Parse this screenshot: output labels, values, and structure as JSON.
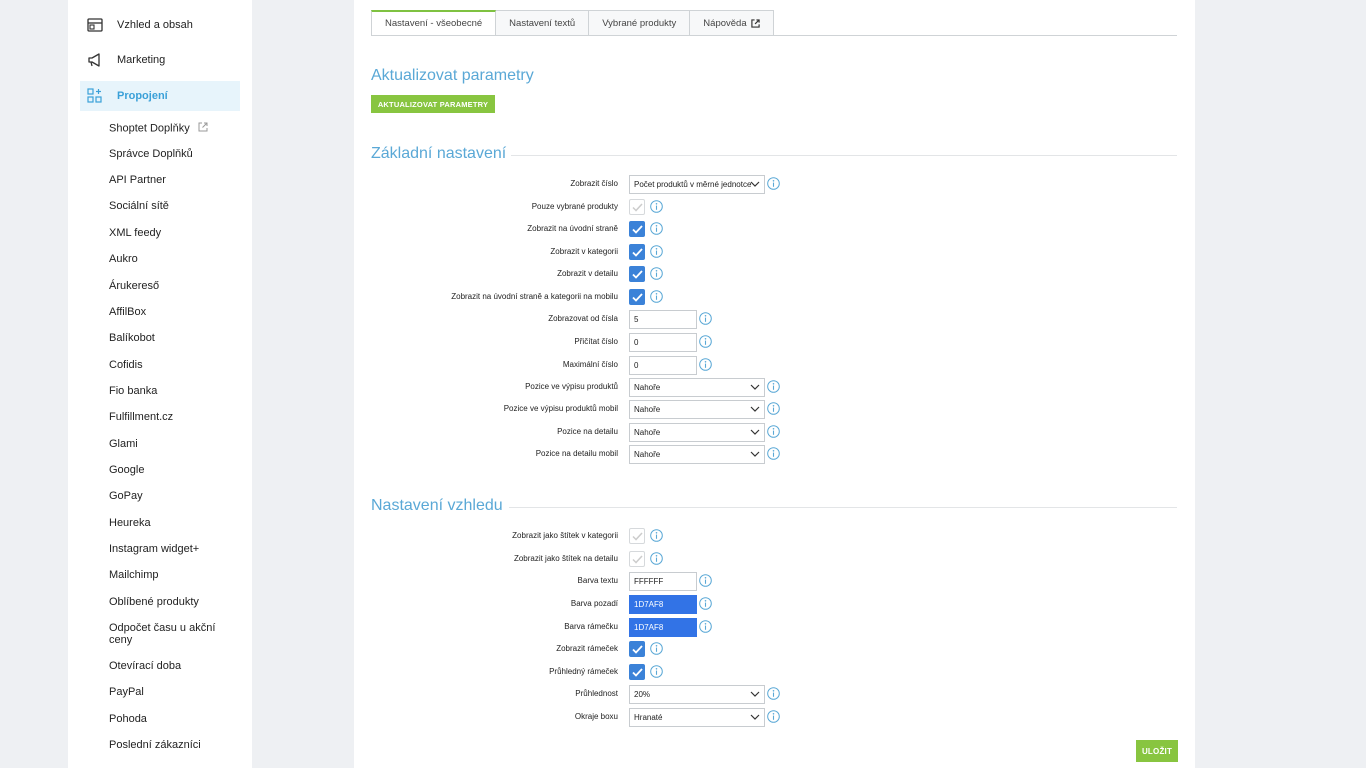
{
  "sidebar": {
    "top_items": [
      {
        "label": "Vzhled a obsah",
        "icon": "layout-icon"
      },
      {
        "label": "Marketing",
        "icon": "megaphone-icon"
      },
      {
        "label": "Propojení",
        "icon": "integrations-icon",
        "active": true
      }
    ],
    "sub_items": [
      "Shoptet Doplňky",
      "Správce Doplňků",
      "API Partner",
      "Sociální sítě",
      "XML feedy",
      "Aukro",
      "Árukereső",
      "AffilBox",
      "Balíkobot",
      "Cofidis",
      "Fio banka",
      "Fulfillment.cz",
      "Glami",
      "Google",
      "GoPay",
      "Heureka",
      "Instagram widget+",
      "Mailchimp",
      "Oblíbené produkty",
      "Odpočet času u akční ceny",
      "Otevírací doba",
      "PayPal",
      "Pohoda",
      "Poslední zákazníci"
    ]
  },
  "tabs": [
    "Nastavení - všeobecné",
    "Nastavení textů",
    "Vybrané produkty",
    "Nápověda"
  ],
  "sections": {
    "update_title": "Aktualizovat parametry",
    "update_button": "AKTUALIZOVAT PARAMETRY",
    "basic_title": "Základní nastavení",
    "look_title": "Nastavení vzhledu"
  },
  "basic_rows": {
    "r0": {
      "label": "Zobrazit číslo",
      "value": "Počet produktů v měrné jednotce"
    },
    "r1": {
      "label": "Pouze vybrané produkty"
    },
    "r2": {
      "label": "Zobrazit na úvodní straně"
    },
    "r3": {
      "label": "Zobrazit v kategorii"
    },
    "r4": {
      "label": "Zobrazit v detailu"
    },
    "r5": {
      "label": "Zobrazit na úvodní straně a kategorii na mobilu"
    },
    "r6": {
      "label": "Zobrazovat od čísla",
      "value": "5"
    },
    "r7": {
      "label": "Přičítat číslo",
      "value": "0"
    },
    "r8": {
      "label": "Maximální číslo",
      "value": "0"
    },
    "r9": {
      "label": "Pozice ve výpisu produktů",
      "value": "Nahoře"
    },
    "r10": {
      "label": "Pozice ve výpisu produktů mobil",
      "value": "Nahoře"
    },
    "r11": {
      "label": "Pozice na detailu",
      "value": "Nahoře"
    },
    "r12": {
      "label": "Pozice na detailu mobil",
      "value": "Nahoře"
    }
  },
  "look_rows": {
    "r0": {
      "label": "Zobrazit jako štítek v kategorii"
    },
    "r1": {
      "label": "Zobrazit jako štítek na detailu"
    },
    "r2": {
      "label": "Barva textu",
      "value": "FFFFFF"
    },
    "r3": {
      "label": "Barva pozadí",
      "value": "1D7AF8"
    },
    "r4": {
      "label": "Barva rámečku",
      "value": "1D7AF8"
    },
    "r5": {
      "label": "Zobrazit rámeček"
    },
    "r6": {
      "label": "Průhledný rámeček"
    },
    "r7": {
      "label": "Průhlednost",
      "value": "20%"
    },
    "r8": {
      "label": "Okraje boxu",
      "value": "Hranaté"
    }
  },
  "save_button": "ULOŽIT",
  "colors": {
    "accent": "#5aa8d6",
    "green": "#88c540",
    "checkbox": "#3b82d8",
    "color_field": "#3273e6"
  }
}
